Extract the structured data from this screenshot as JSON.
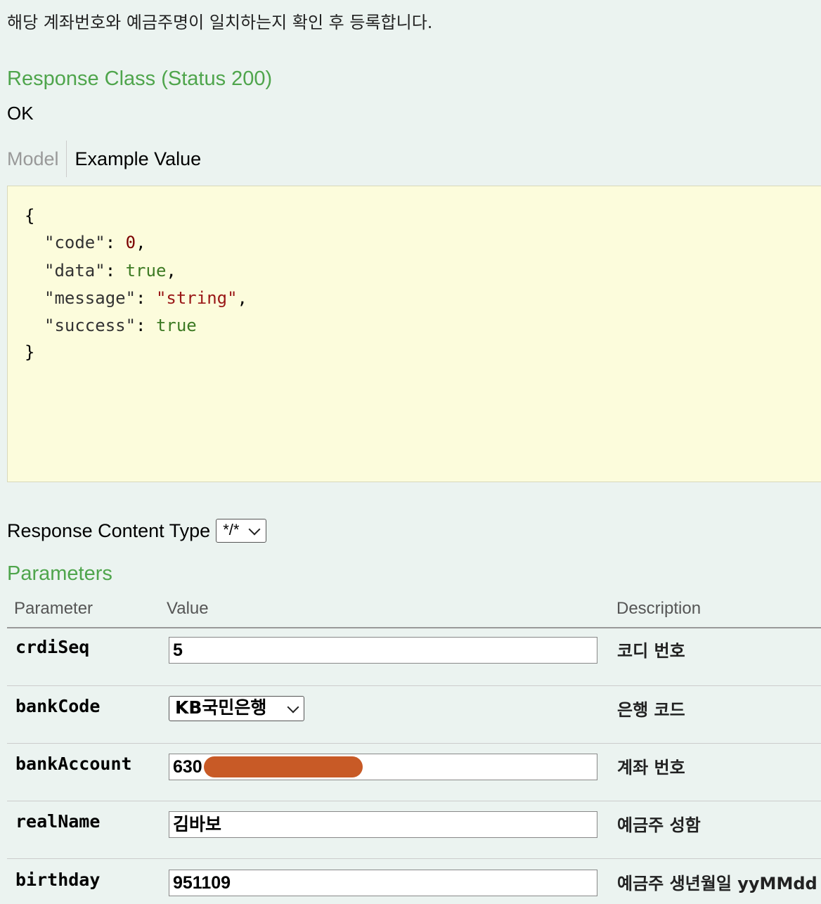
{
  "description": "해당 계좌번호와 예금주명이 일치하는지 확인 후 등록합니다.",
  "response_class": {
    "title": "Response Class (Status 200)",
    "status_text": "OK"
  },
  "tabs": {
    "model": "Model",
    "example_value": "Example Value"
  },
  "example": {
    "open_brace": "{",
    "close_brace": "}",
    "fields": [
      {
        "key": "\"code\"",
        "value": "0",
        "suffix": ","
      },
      {
        "key": "\"data\"",
        "value": "true",
        "suffix": ","
      },
      {
        "key": "\"message\"",
        "value": "\"string\"",
        "suffix": ","
      },
      {
        "key": "\"success\"",
        "value": "true",
        "suffix": ""
      }
    ]
  },
  "response_content_type": {
    "label": "Response Content Type",
    "selected": "*/*"
  },
  "parameters": {
    "title": "Parameters",
    "headers": {
      "parameter": "Parameter",
      "value": "Value",
      "description": "Description"
    },
    "rows": [
      {
        "name": "crdiSeq",
        "value": "5",
        "description": "코디 번호"
      },
      {
        "name": "bankCode",
        "value": "KB국민은행",
        "description": "은행 코드"
      },
      {
        "name": "bankAccount",
        "value": "630",
        "description": "계좌 번호"
      },
      {
        "name": "realName",
        "value": "김바보",
        "description": "예금주 성함"
      },
      {
        "name": "birthday",
        "value": "951109",
        "description": "예금주 생년월일 yyMMdd"
      }
    ]
  },
  "colors": {
    "background": "#ebf3f0",
    "section_title": "#4fa54c",
    "code_background": "#fcfcdc",
    "redaction": "#c85a26"
  }
}
